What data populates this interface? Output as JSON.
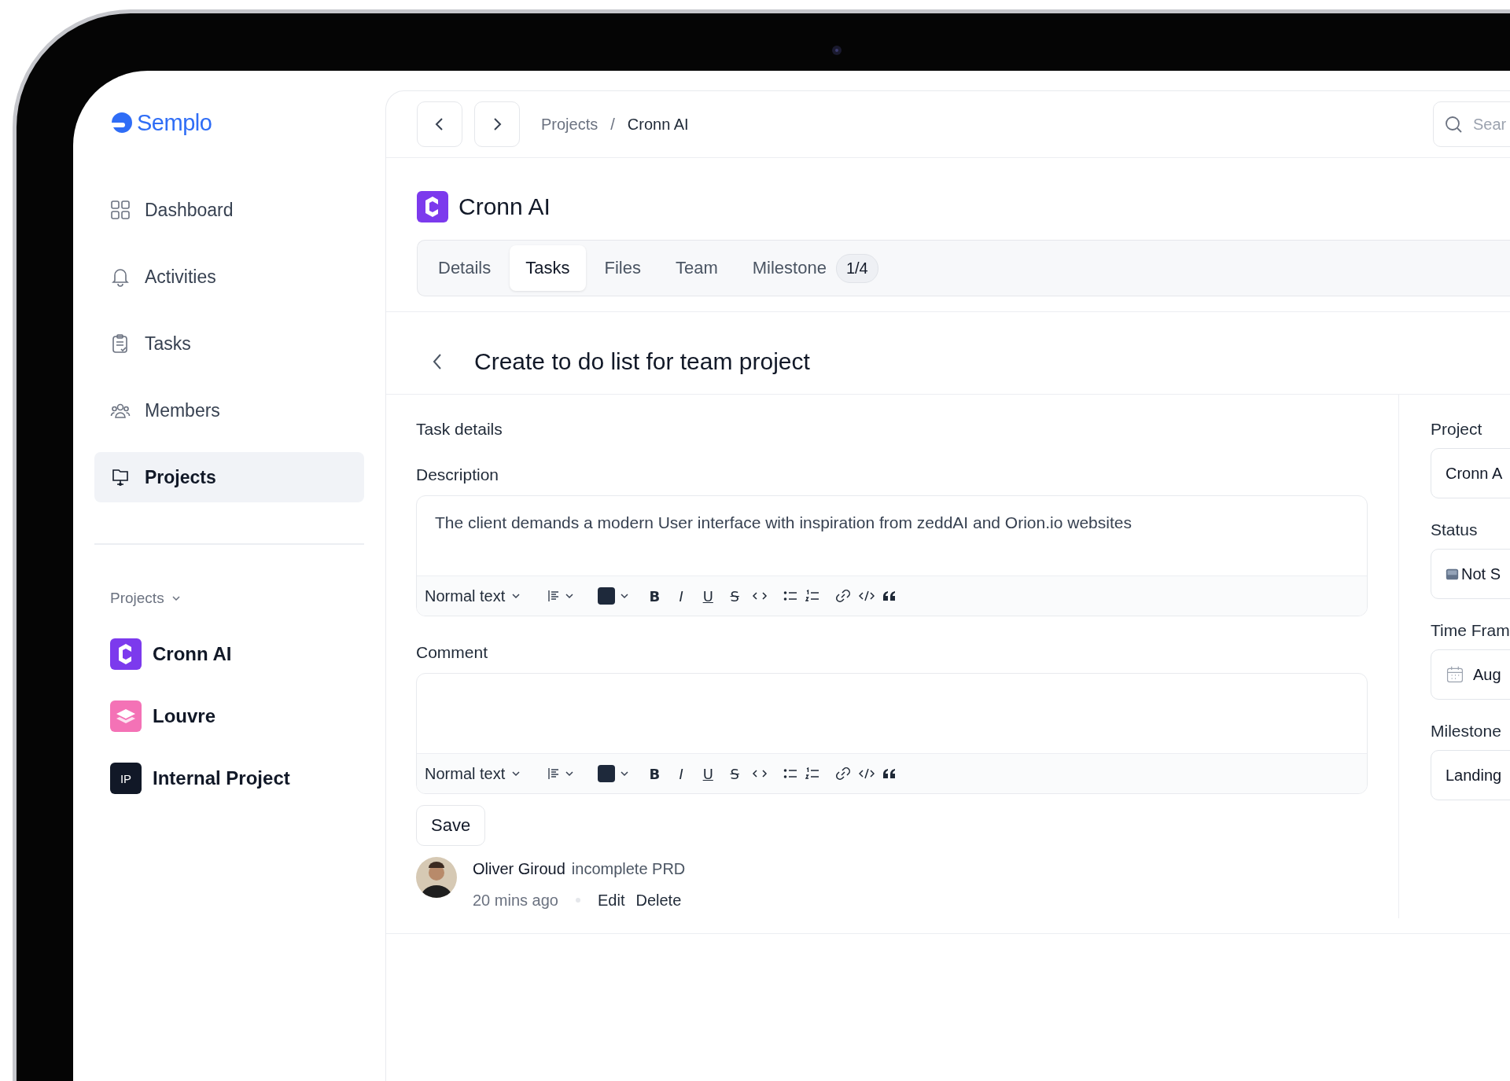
{
  "logo": {
    "name": "Semplo"
  },
  "nav": [
    {
      "label": "Dashboard",
      "selected": false
    },
    {
      "label": "Activities",
      "selected": false
    },
    {
      "label": "Tasks",
      "selected": false
    },
    {
      "label": "Members",
      "selected": false
    },
    {
      "label": "Projects",
      "selected": true
    }
  ],
  "projects_section": {
    "title": "Projects",
    "expanded": true,
    "items": [
      {
        "name": "Cronn AI",
        "kind": "cronn"
      },
      {
        "name": "Louvre",
        "kind": "louvre"
      },
      {
        "name": "Internal Project",
        "kind": "initials",
        "initials": "IP"
      }
    ]
  },
  "breadcrumb": [
    "Projects",
    "Cronn AI"
  ],
  "breadcrumb_separator": "/",
  "search": {
    "placeholder": "Sear"
  },
  "project": {
    "title": "Cronn AI"
  },
  "tabs": [
    {
      "label": "Details",
      "selected": false
    },
    {
      "label": "Tasks",
      "selected": true
    },
    {
      "label": "Files",
      "selected": false
    },
    {
      "label": "Team",
      "selected": false
    },
    {
      "label": "Milestone",
      "selected": false,
      "badge": "1/4"
    }
  ],
  "task": {
    "title": "Create to do list for team project"
  },
  "task_details": {
    "heading": "Task details",
    "editors": [
      {
        "label": "Description",
        "value": "The client demands a modern User interface with inspiration from zeddAI and Orion.io websites",
        "toolbar": [
          {
            "kind": "style",
            "label": "Normal text"
          },
          {
            "kind": "align"
          },
          {
            "kind": "color"
          },
          {
            "kind": "bold",
            "label": "B"
          },
          {
            "kind": "italic",
            "label": "I"
          },
          {
            "kind": "underline",
            "label": "U"
          },
          {
            "kind": "strike",
            "label": "S"
          },
          {
            "kind": "code"
          },
          {
            "kind": "bullets"
          },
          {
            "kind": "numbered"
          },
          {
            "kind": "link"
          },
          {
            "kind": "codeblock"
          },
          {
            "kind": "quote"
          }
        ]
      },
      {
        "label": "Comment",
        "toolbar": [
          {
            "kind": "style",
            "label": "Normal text"
          },
          {
            "kind": "align"
          },
          {
            "kind": "color"
          },
          {
            "kind": "bold",
            "label": "B"
          },
          {
            "kind": "italic",
            "label": "I"
          },
          {
            "kind": "underline",
            "label": "U"
          },
          {
            "kind": "strike",
            "label": "S"
          },
          {
            "kind": "code"
          },
          {
            "kind": "bullets"
          },
          {
            "kind": "numbered"
          },
          {
            "kind": "link"
          },
          {
            "kind": "codeblock"
          },
          {
            "kind": "quote"
          }
        ]
      }
    ],
    "save_button": "Save",
    "comment": {
      "author": "Oliver Giroud",
      "text": "incomplete PRD",
      "time": "20 mins ago",
      "actions": [
        "Edit",
        "Delete"
      ]
    }
  },
  "side_fields": [
    {
      "label": "Project",
      "value": "Cronn A",
      "kind": "text"
    },
    {
      "label": "Status",
      "value": "Not S",
      "kind": "status"
    },
    {
      "label": "Time Fram",
      "value": "Aug",
      "kind": "date"
    },
    {
      "label": "Milestone",
      "value": "Landing",
      "kind": "text"
    }
  ]
}
